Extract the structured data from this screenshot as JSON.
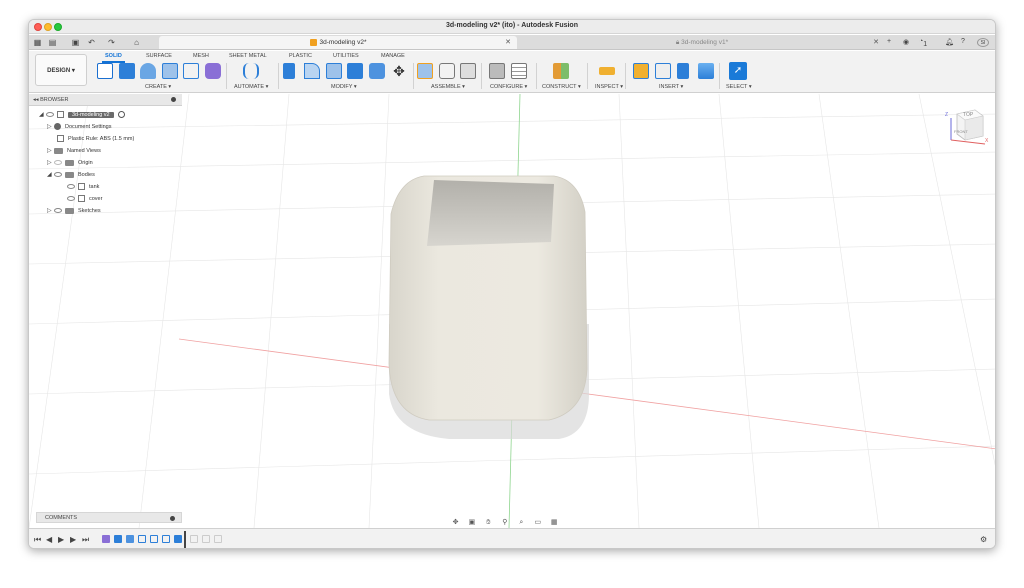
{
  "window": {
    "title": "3d-modeling v2* (ito) - Autodesk Fusion"
  },
  "tabs": [
    {
      "label": "3d-modeling v2*",
      "active": true
    },
    {
      "label": "3d-modeling v1*",
      "active": false
    }
  ],
  "user": {
    "initials": "SI",
    "job_count": "1"
  },
  "toolbar": {
    "workspace": "DESIGN ▾",
    "workspace_tabs": [
      "SOLID",
      "SURFACE",
      "MESH",
      "SHEET METAL",
      "PLASTIC",
      "UTILITIES",
      "MANAGE"
    ],
    "groups": [
      "CREATE ▾",
      "AUTOMATE ▾",
      "MODIFY ▾",
      "ASSEMBLE ▾",
      "CONFIGURE ▾",
      "CONSTRUCT ▾",
      "INSPECT ▾",
      "INSERT ▾",
      "SELECT ▾"
    ]
  },
  "browser": {
    "title": "BROWSER",
    "root": "3d-modeling v2",
    "items": [
      {
        "label": "Document Settings"
      },
      {
        "label": "Plastic Rule: ABS (1.5 mm)"
      },
      {
        "label": "Named Views"
      },
      {
        "label": "Origin"
      },
      {
        "label": "Bodies"
      },
      {
        "label": "tank"
      },
      {
        "label": "cover"
      },
      {
        "label": "Sketches"
      }
    ]
  },
  "viewcube": {
    "top": "TOP",
    "front": "FRONT",
    "axis_x": "X",
    "axis_z": "Z"
  },
  "comments": {
    "title": "COMMENTS"
  },
  "colors": {
    "accent": "#1273d6",
    "body": "#e9e6dc"
  }
}
